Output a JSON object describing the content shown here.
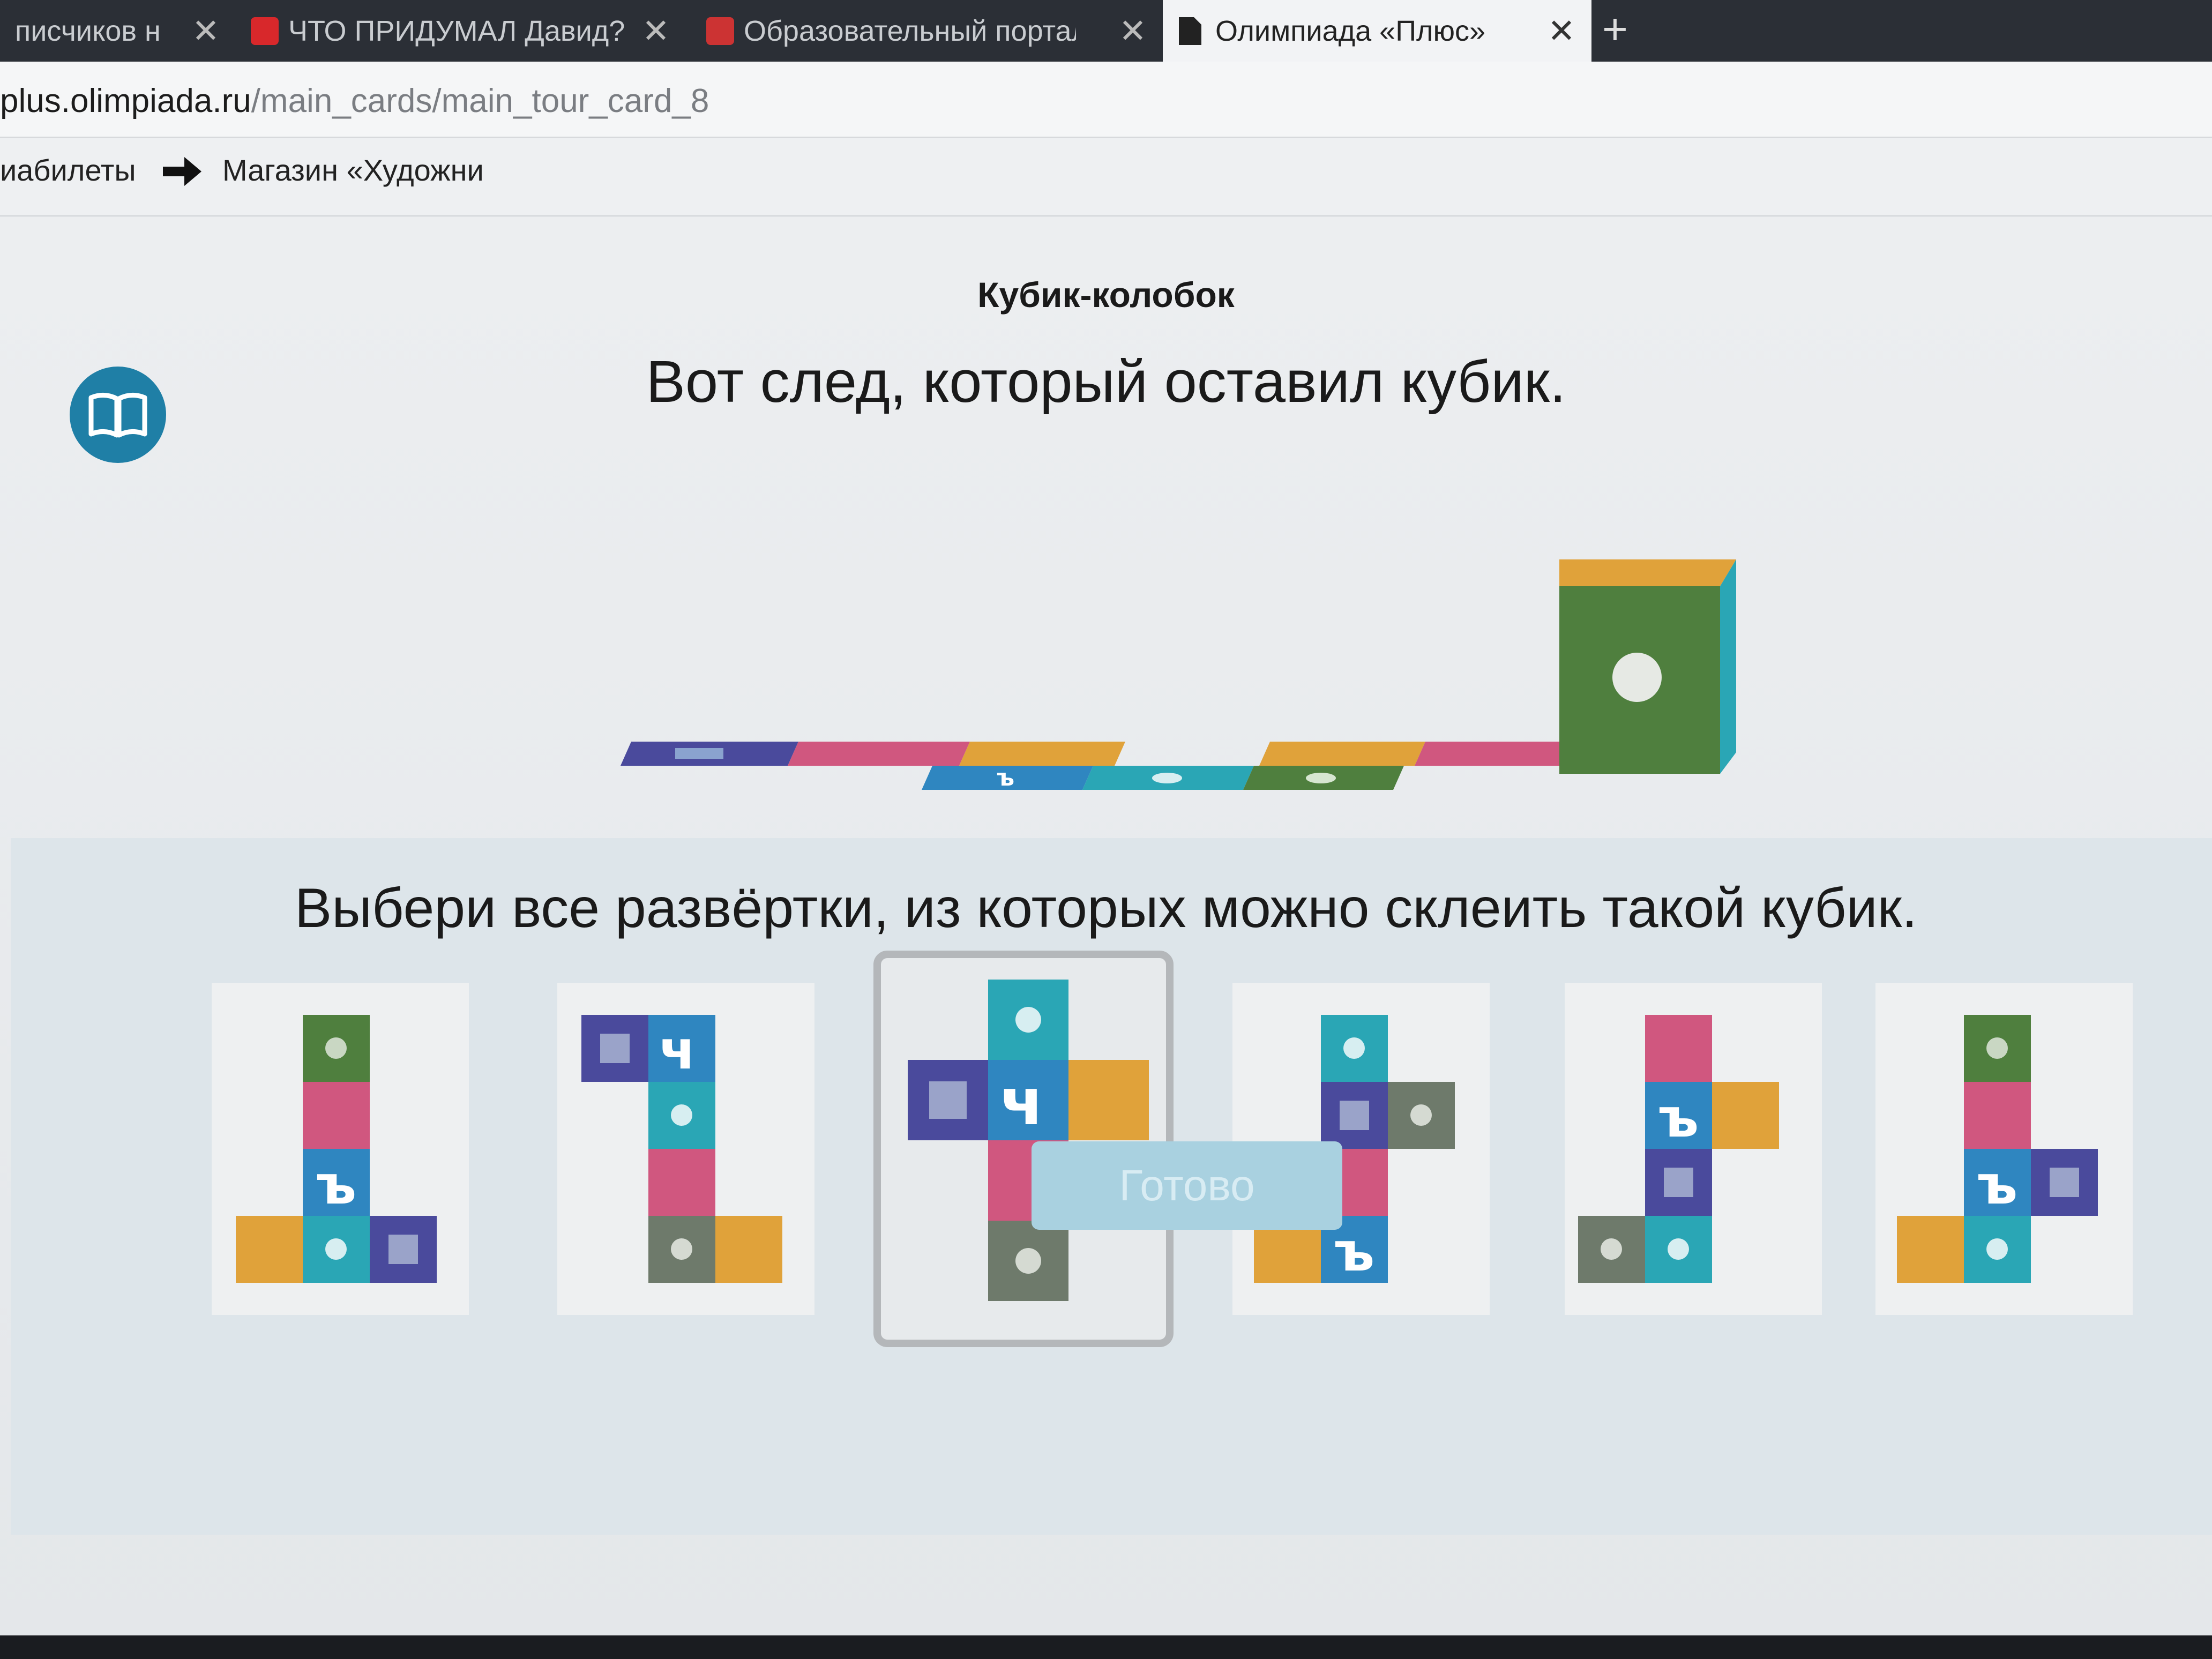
{
  "browser": {
    "tabs": [
      {
        "title": "писчиков н",
        "active": false
      },
      {
        "title": "ЧТО ПРИДУМАЛ Давид?",
        "active": false
      },
      {
        "title": "Образовательный портал",
        "active": false
      },
      {
        "title": "Олимпиада «Плюс»",
        "active": true
      }
    ],
    "close_glyph": "✕",
    "new_tab_glyph": "+",
    "url_domain": "plus.olimpiada.ru",
    "url_path": "/main_cards/main_tour_card_8"
  },
  "bookmarks": [
    {
      "label": "иабилеты"
    },
    {
      "label": "Магазин «Художни"
    }
  ],
  "page": {
    "title": "Кубик-колобок",
    "prompt_trail": "Вот след, который оставил кубик.",
    "prompt_choose": "Выбери все развёртки, из которых можно склеить такой кубик.",
    "ready_button": "Готово"
  },
  "colors": {
    "green": "#4f7f3e",
    "pink": "#d0577f",
    "blue": "#2f86c0",
    "teal": "#2aa6b5",
    "purple": "#4a4a9c",
    "orange": "#e0a23a",
    "gray": "#6e7a6b",
    "accent": "#1f7fa6"
  },
  "icons": {
    "book": "book-icon",
    "arrow": "arrow-right-icon"
  },
  "options": [
    {
      "selected": false
    },
    {
      "selected": false
    },
    {
      "selected": true
    },
    {
      "selected": false
    },
    {
      "selected": false
    },
    {
      "selected": false
    }
  ]
}
